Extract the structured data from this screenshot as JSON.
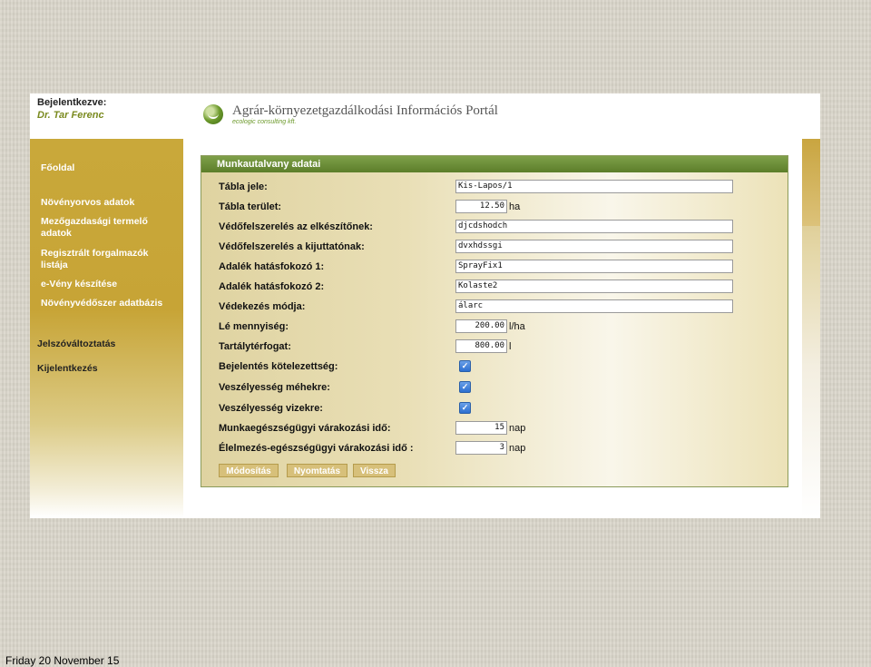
{
  "login": {
    "label": "Bejelentkezve:",
    "user": "Dr. Tar Ferenc"
  },
  "header": {
    "title": "Agrár-környezetgazdálkodási Információs Portál",
    "subtitle": "ecologic consulting kft."
  },
  "sidebar": {
    "items": [
      {
        "label": "Főoldal"
      },
      {
        "label": "Növényorvos adatok"
      },
      {
        "label": "Mezőgazdasági termelő adatok"
      },
      {
        "label": "Regisztrált forgalmazók listája"
      },
      {
        "label": "e-Vény készítése"
      },
      {
        "label": "Növényvédőszer adatbázis"
      },
      {
        "label": "Jelszóváltoztatás"
      },
      {
        "label": "Kijelentkezés"
      }
    ]
  },
  "panel": {
    "title": "Munkautalvany adatai",
    "rows": [
      {
        "label": "Tábla jele:",
        "value": "Kis-Lapos/1"
      },
      {
        "label": "Tábla terület:",
        "value": "12.50",
        "unit": "ha"
      },
      {
        "label": "Védőfelszerelés az elkészítőnek:",
        "value": "djcdshodch"
      },
      {
        "label": "Védőfelszerelés a kijuttatónak:",
        "value": "dvxhdssgi"
      },
      {
        "label": "Adalék hatásfokozó 1:",
        "value": "SprayFix1"
      },
      {
        "label": "Adalék hatásfokozó 2:",
        "value": "Kolaste2"
      },
      {
        "label": "Védekezés módja:",
        "value": "álarc"
      },
      {
        "label": "Lé mennyiség:",
        "value": "200.00",
        "unit": "l/ha"
      },
      {
        "label": "Tartálytérfogat:",
        "value": "800.00",
        "unit": "l"
      },
      {
        "label": "Bejelentés kötelezettség:",
        "checked": true
      },
      {
        "label": "Veszélyesség méhekre:",
        "checked": true
      },
      {
        "label": "Veszélyesség vizekre:",
        "checked": true
      },
      {
        "label": "Munkaegészségügyi várakozási idő:",
        "value": "15",
        "unit": "nap"
      },
      {
        "label": "Élelmezés-egészségügyi várakozási idő :",
        "value": "3",
        "unit": "nap"
      }
    ],
    "buttons": {
      "modify": "Módosítás",
      "print": "Nyomtatás",
      "back": "Vissza"
    }
  },
  "footer": {
    "date": "Friday 20 November 15"
  },
  "colors": {
    "header_green": "#6d8f35",
    "sidebar_gold": "#c9a83a",
    "button_gold": "#d7c07a"
  }
}
